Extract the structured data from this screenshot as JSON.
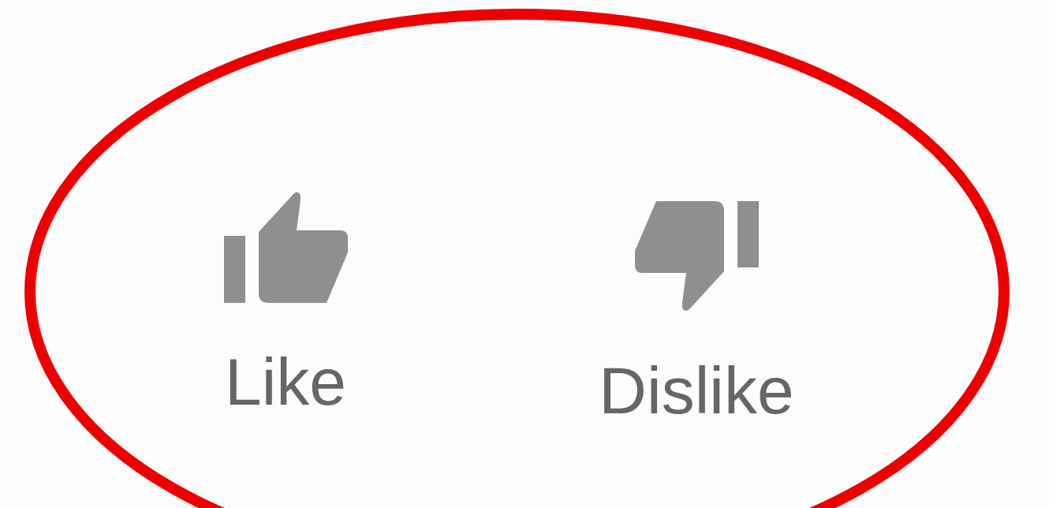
{
  "buttons": [
    {
      "kind": "like",
      "label": "Like",
      "selected": false
    },
    {
      "kind": "dislike",
      "label": "Dislike",
      "selected": false
    }
  ],
  "annotations": [
    {
      "kind": "ellipse"
    }
  ]
}
